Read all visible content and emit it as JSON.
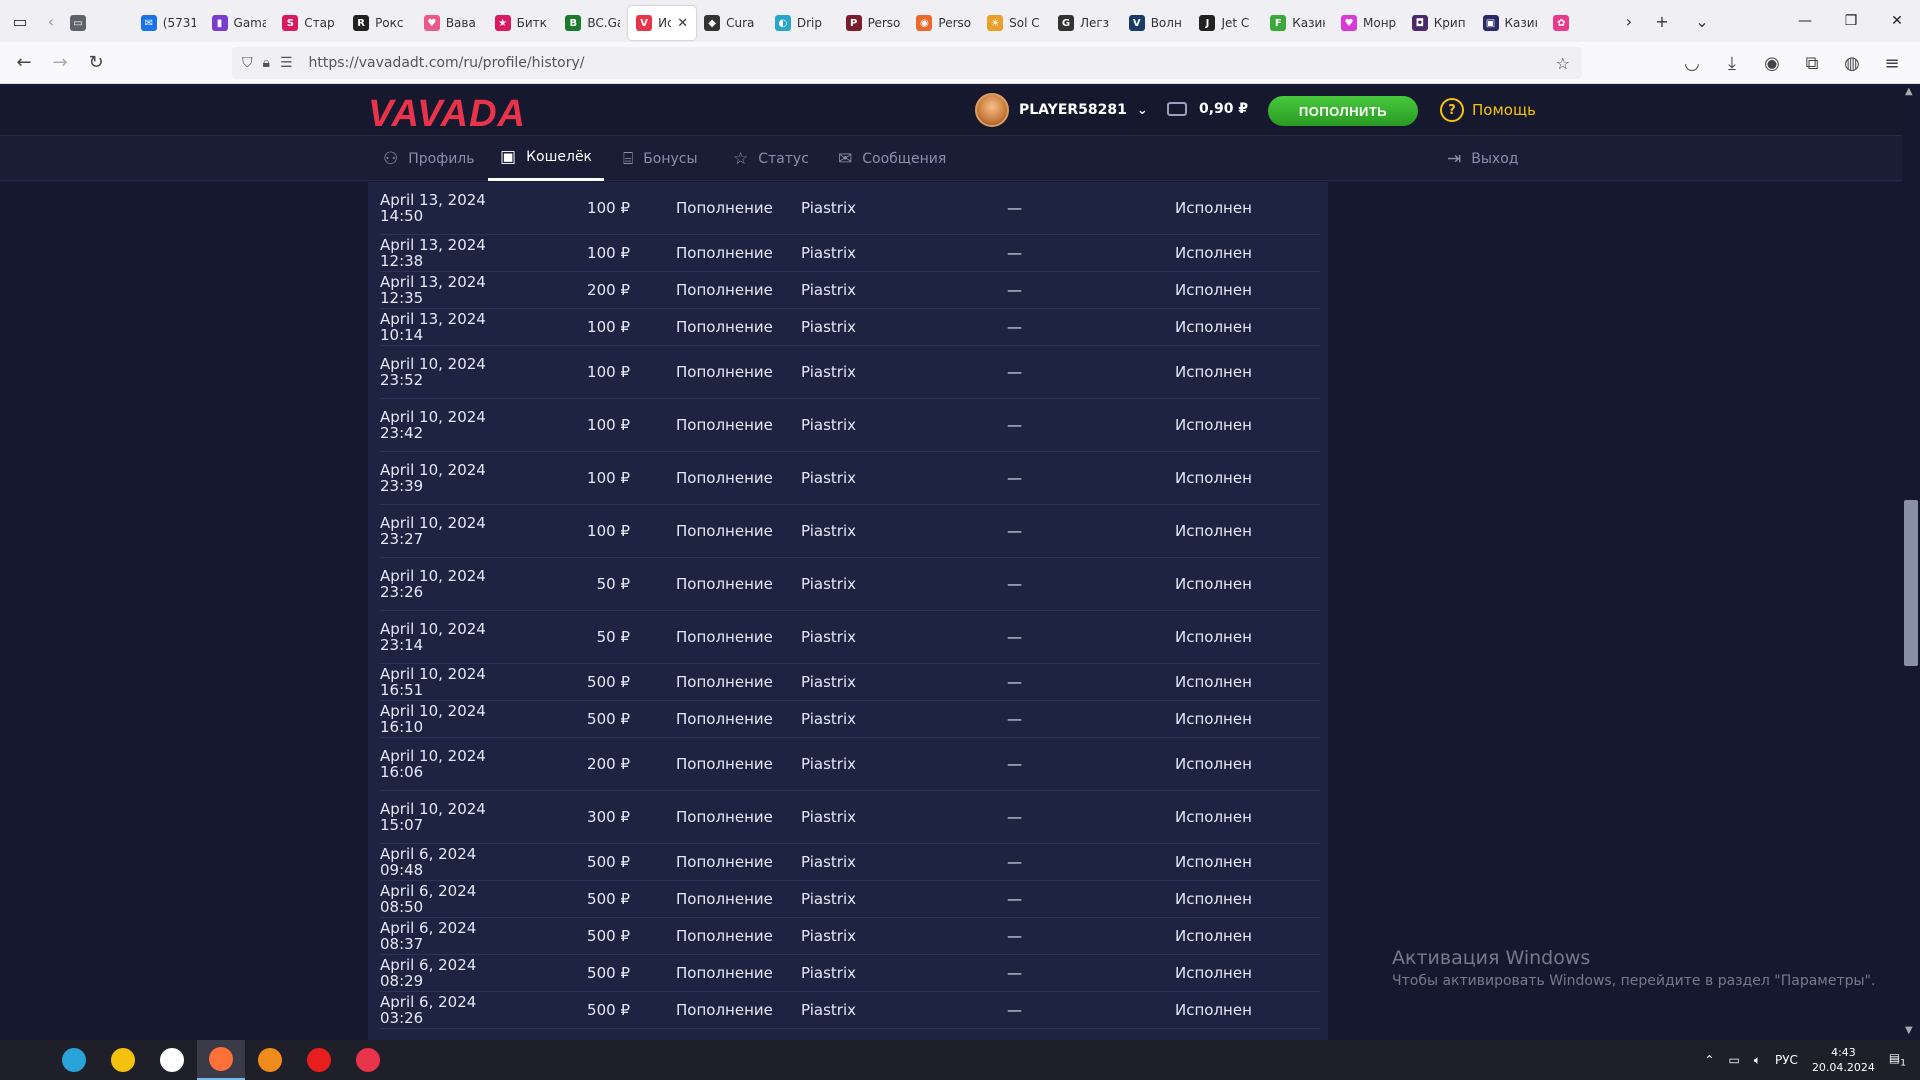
{
  "browser": {
    "tabs": [
      {
        "label": "",
        "color": "#5f6368",
        "glyph": "▭"
      },
      {
        "label": "(5731",
        "color": "#1a73e8",
        "glyph": "✉"
      },
      {
        "label": "Gama",
        "color": "#7a3ccf",
        "glyph": "▮"
      },
      {
        "label": "Стар",
        "color": "#d81b60",
        "glyph": "S"
      },
      {
        "label": "Рокс",
        "color": "#222222",
        "glyph": "R"
      },
      {
        "label": "Вава",
        "color": "#e85a8a",
        "glyph": "♥"
      },
      {
        "label": "Битк",
        "color": "#d81b60",
        "glyph": "★"
      },
      {
        "label": "BC.Ga",
        "color": "#1b7a2b",
        "glyph": "B"
      },
      {
        "label": "Ис",
        "color": "#e8344a",
        "glyph": "V",
        "active": true
      },
      {
        "label": "Cura",
        "color": "#333333",
        "glyph": "◆"
      },
      {
        "label": "Drip",
        "color": "#2aa7c8",
        "glyph": "◐"
      },
      {
        "label": "Perso",
        "color": "#7a1e2e",
        "glyph": "P"
      },
      {
        "label": "Perso",
        "color": "#e86a2a",
        "glyph": "◉"
      },
      {
        "label": "Sol C",
        "color": "#e8a02a",
        "glyph": "☀"
      },
      {
        "label": "Легз",
        "color": "#333333",
        "glyph": "G"
      },
      {
        "label": "Волн",
        "color": "#1a3a6a",
        "glyph": "V"
      },
      {
        "label": "Jet C",
        "color": "#222222",
        "glyph": "J"
      },
      {
        "label": "Казин",
        "color": "#3aa83a",
        "glyph": "F"
      },
      {
        "label": "Монр",
        "color": "#d83ad8",
        "glyph": "♥"
      },
      {
        "label": "Крип",
        "color": "#4a2a6a",
        "glyph": "◘"
      },
      {
        "label": "Казин",
        "color": "#2a2a6a",
        "glyph": "▣"
      },
      {
        "label": "",
        "color": "#e83a8a",
        "glyph": "✿"
      }
    ],
    "close_glyph": "✕",
    "url": "https://vavadadt.com/ru/profile/history/"
  },
  "site": {
    "logo": "VAVADA",
    "username": "PLAYER58281",
    "balance": "0,90 ₽",
    "deposit_label": "ПОПОЛНИТЬ",
    "help_label": "Помощь",
    "tabs": {
      "profile": "Профиль",
      "wallet": "Кошелёк",
      "bonuses": "Бонусы",
      "status": "Статус",
      "messages": "Сообщения",
      "logout": "Выход"
    },
    "rows": [
      {
        "date": "April 13, 2024 14:50",
        "amount": "100 ₽",
        "type": "Пополнение",
        "system": "Piastrix",
        "extra": "—",
        "status": "Исполнен",
        "tall": true
      },
      {
        "date": "April 13, 2024 12:38",
        "amount": "100 ₽",
        "type": "Пополнение",
        "system": "Piastrix",
        "extra": "—",
        "status": "Исполнен",
        "tall": false
      },
      {
        "date": "April 13, 2024 12:35",
        "amount": "200 ₽",
        "type": "Пополнение",
        "system": "Piastrix",
        "extra": "—",
        "status": "Исполнен",
        "tall": false
      },
      {
        "date": "April 13, 2024 10:14",
        "amount": "100 ₽",
        "type": "Пополнение",
        "system": "Piastrix",
        "extra": "—",
        "status": "Исполнен",
        "tall": false
      },
      {
        "date": "April 10, 2024 23:52",
        "amount": "100 ₽",
        "type": "Пополнение",
        "system": "Piastrix",
        "extra": "—",
        "status": "Исполнен",
        "tall": true
      },
      {
        "date": "April 10, 2024 23:42",
        "amount": "100 ₽",
        "type": "Пополнение",
        "system": "Piastrix",
        "extra": "—",
        "status": "Исполнен",
        "tall": true
      },
      {
        "date": "April 10, 2024 23:39",
        "amount": "100 ₽",
        "type": "Пополнение",
        "system": "Piastrix",
        "extra": "—",
        "status": "Исполнен",
        "tall": true
      },
      {
        "date": "April 10, 2024 23:27",
        "amount": "100 ₽",
        "type": "Пополнение",
        "system": "Piastrix",
        "extra": "—",
        "status": "Исполнен",
        "tall": true
      },
      {
        "date": "April 10, 2024 23:26",
        "amount": "50 ₽",
        "type": "Пополнение",
        "system": "Piastrix",
        "extra": "—",
        "status": "Исполнен",
        "tall": true
      },
      {
        "date": "April 10, 2024 23:14",
        "amount": "50 ₽",
        "type": "Пополнение",
        "system": "Piastrix",
        "extra": "—",
        "status": "Исполнен",
        "tall": true
      },
      {
        "date": "April 10, 2024 16:51",
        "amount": "500 ₽",
        "type": "Пополнение",
        "system": "Piastrix",
        "extra": "—",
        "status": "Исполнен",
        "tall": false
      },
      {
        "date": "April 10, 2024 16:10",
        "amount": "500 ₽",
        "type": "Пополнение",
        "system": "Piastrix",
        "extra": "—",
        "status": "Исполнен",
        "tall": false
      },
      {
        "date": "April 10, 2024 16:06",
        "amount": "200 ₽",
        "type": "Пополнение",
        "system": "Piastrix",
        "extra": "—",
        "status": "Исполнен",
        "tall": true
      },
      {
        "date": "April 10, 2024 15:07",
        "amount": "300 ₽",
        "type": "Пополнение",
        "system": "Piastrix",
        "extra": "—",
        "status": "Исполнен",
        "tall": true
      },
      {
        "date": "April 6, 2024 09:48",
        "amount": "500 ₽",
        "type": "Пополнение",
        "system": "Piastrix",
        "extra": "—",
        "status": "Исполнен",
        "tall": false
      },
      {
        "date": "April 6, 2024 08:50",
        "amount": "500 ₽",
        "type": "Пополнение",
        "system": "Piastrix",
        "extra": "—",
        "status": "Исполнен",
        "tall": false
      },
      {
        "date": "April 6, 2024 08:37",
        "amount": "500 ₽",
        "type": "Пополнение",
        "system": "Piastrix",
        "extra": "—",
        "status": "Исполнен",
        "tall": false
      },
      {
        "date": "April 6, 2024 08:29",
        "amount": "500 ₽",
        "type": "Пополнение",
        "system": "Piastrix",
        "extra": "—",
        "status": "Исполнен",
        "tall": false
      },
      {
        "date": "April 6, 2024 03:26",
        "amount": "500 ₽",
        "type": "Пополнение",
        "system": "Piastrix",
        "extra": "—",
        "status": "Исполнен",
        "tall": false
      }
    ]
  },
  "watermark": {
    "title": "Активация Windows",
    "subtitle": "Чтобы активировать Windows, перейдите в раздел \"Параметры\"."
  },
  "taskbar": {
    "lang": "РУС",
    "time": "4:43",
    "date": "20.04.2024",
    "notif_count": "1",
    "apps": [
      {
        "name": "edge",
        "color": "#2aa3d8"
      },
      {
        "name": "explorer",
        "color": "#f4c20d"
      },
      {
        "name": "app-g",
        "color": "#ffffff"
      },
      {
        "name": "firefox",
        "color": "#ff7139"
      },
      {
        "name": "vlc",
        "color": "#f08c1a"
      },
      {
        "name": "recorder",
        "color": "#e81e1e"
      },
      {
        "name": "obs",
        "color": "#e8344a"
      }
    ]
  }
}
